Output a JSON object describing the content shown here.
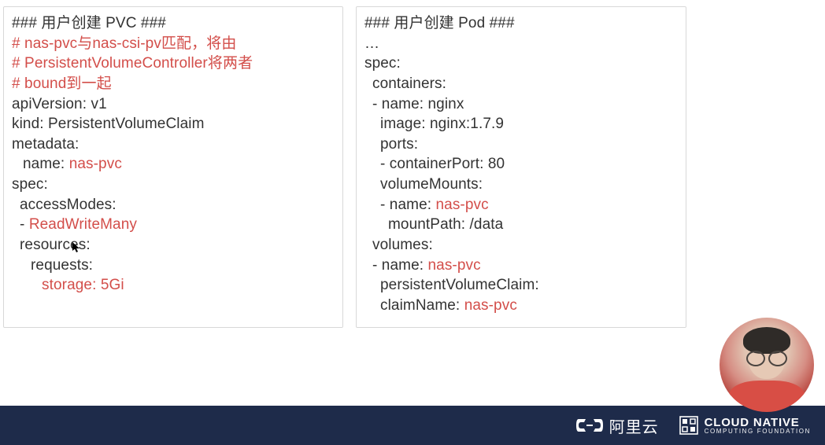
{
  "left_box": {
    "header": "### 用户创建 PVC ###",
    "comments": [
      "# nas-pvc与nas-csi-pv匹配，将由",
      "# PersistentVolumeController将两者",
      "# bound到一起"
    ],
    "apiVersion_key": "apiVersion: ",
    "apiVersion_val": "v1",
    "kind_key": "kind: ",
    "kind_val": "PersistentVolumeClaim",
    "metadata": "metadata:",
    "name_key": "name: ",
    "name_val": "nas-pvc",
    "spec": "spec:",
    "accessModes": "accessModes:",
    "accessModes_item_dash": "- ",
    "accessModes_item_val": "ReadWriteMany",
    "resources": "resources:",
    "requests": "requests:",
    "storage_key": "storage: ",
    "storage_val": "5Gi"
  },
  "right_box": {
    "header": "### 用户创建 Pod ###",
    "ellipsis": "…",
    "spec": "spec:",
    "containers": "containers:",
    "c_name": "- name: nginx",
    "c_image": "image: nginx:1.7.9",
    "c_ports": "ports:",
    "c_port_item": "- containerPort: 80",
    "volumeMounts": "volumeMounts:",
    "vm_name_key": "- name: ",
    "vm_name_val": "nas-pvc",
    "vm_mountPath": "mountPath: /data",
    "volumes": "volumes:",
    "v_name_key": "- name: ",
    "v_name_val": "nas-pvc",
    "pvc_key": "persistentVolumeClaim:",
    "claimName_key": "claimName: ",
    "claimName_val": "nas-pvc"
  },
  "footer": {
    "aliyun": "阿里云",
    "cncf_top": "CLOUD NATIVE",
    "cncf_bot": "COMPUTING FOUNDATION"
  }
}
